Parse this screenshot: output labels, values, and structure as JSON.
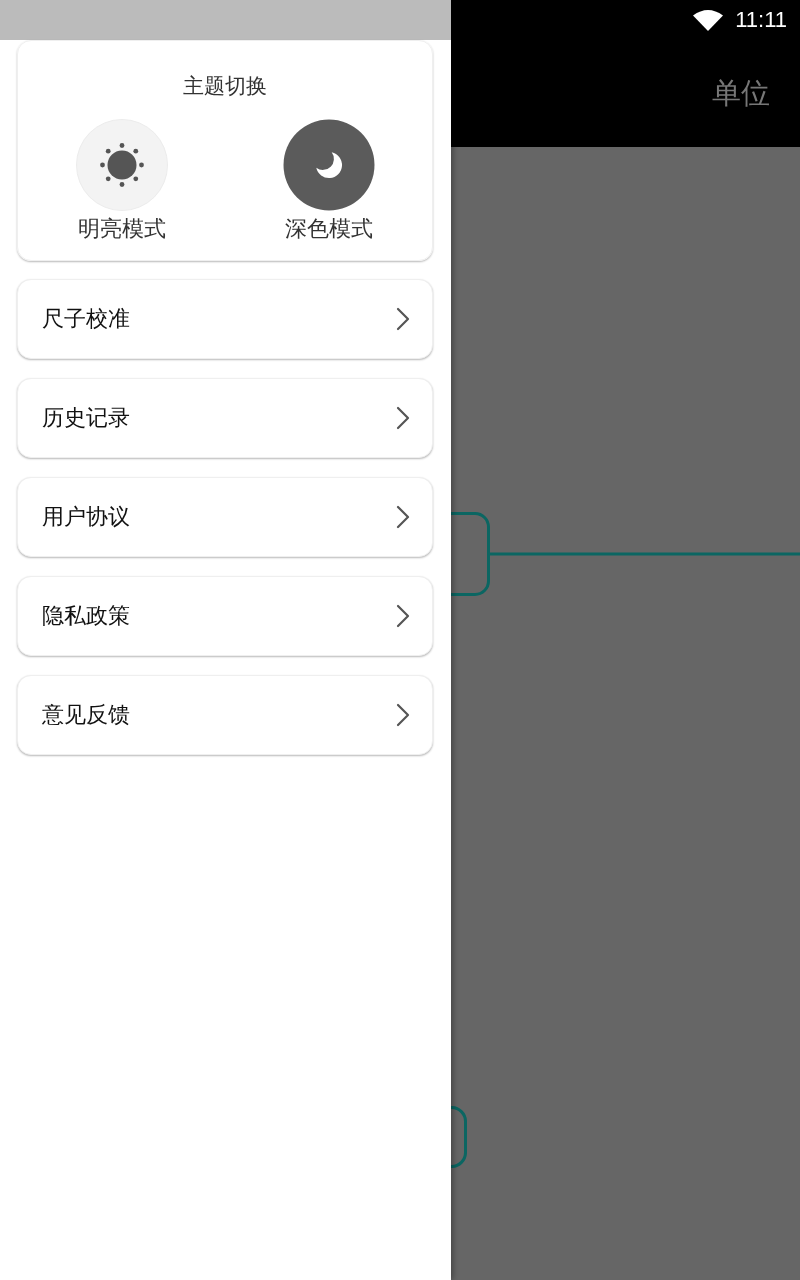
{
  "status_bar": {
    "time": "11:11"
  },
  "app_bar": {
    "action": "单位"
  },
  "drawer": {
    "theme_card": {
      "title": "主题切换",
      "options": [
        {
          "label": "明亮模式",
          "kind": "light"
        },
        {
          "label": "深色模式",
          "kind": "dark"
        }
      ]
    },
    "menu_items": [
      {
        "label": "尺子校准"
      },
      {
        "label": "历史记录"
      },
      {
        "label": "用户协议"
      },
      {
        "label": "隐私政策"
      },
      {
        "label": "意见反馈"
      }
    ]
  }
}
